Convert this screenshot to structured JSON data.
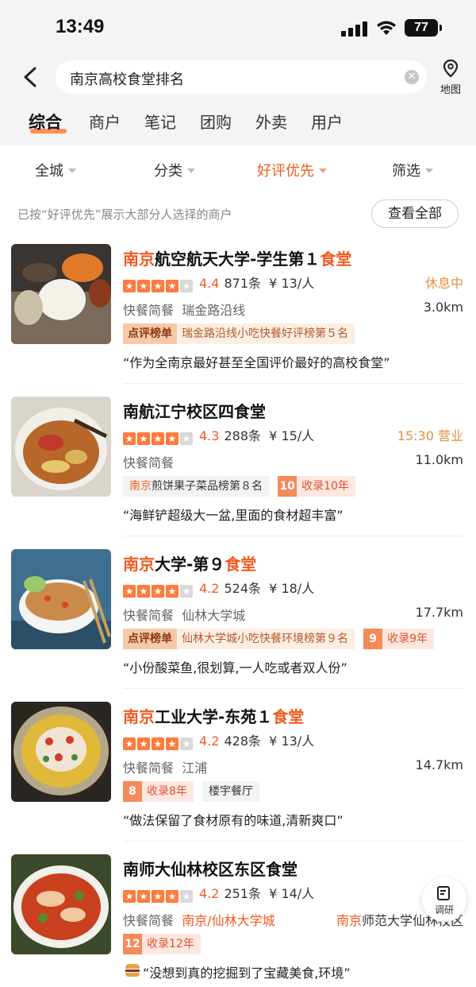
{
  "status_bar": {
    "time": "13:49",
    "battery": "77"
  },
  "search": {
    "query": "南京高校食堂排名",
    "map_label": "地图"
  },
  "tabs": [
    {
      "label": "综合",
      "active": true
    },
    {
      "label": "商户"
    },
    {
      "label": "笔记"
    },
    {
      "label": "团购"
    },
    {
      "label": "外卖"
    },
    {
      "label": "用户"
    }
  ],
  "filters": [
    {
      "label": "全城"
    },
    {
      "label": "分类"
    },
    {
      "label": "好评优先",
      "active": true
    },
    {
      "label": "筛选"
    }
  ],
  "notice": "已按“好评优先”展示大部分人选择的商户",
  "view_all": "查看全部",
  "accent_color": "#f05a20",
  "items": [
    {
      "title_parts": [
        "南京",
        "航空航天大学-学生第１",
        "食堂"
      ],
      "score": "4.4",
      "reviews": "871条",
      "price": "¥ 13/人",
      "status": "休息中",
      "meta_a": "快餐简餐",
      "meta_b": "瑞金路沿线",
      "distance": "3.0km",
      "rank_head": "点评榜单",
      "rank_text": "瑞金路沿线小吃快餐好评榜第５名",
      "quote": "“作为全南京最好甚至全国评价最好的高校食堂”"
    },
    {
      "title_parts": [
        "",
        "南航江宁校区四食堂",
        ""
      ],
      "score": "4.3",
      "reviews": "288条",
      "price": "¥ 15/人",
      "status": "15:30 营业",
      "meta_a": "快餐简餐",
      "meta_b": "",
      "distance": "11.0km",
      "plain_hl": "南京",
      "plain_text": "煎饼果子菜品榜第８名",
      "years_num": "10",
      "years_text": "收录10年",
      "quote": "“海鲜铲超级大一盆,里面的食材超丰富”"
    },
    {
      "title_parts": [
        "南京",
        "大学-第９",
        "食堂"
      ],
      "score": "4.2",
      "reviews": "524条",
      "price": "¥ 18/人",
      "meta_a": "快餐简餐",
      "meta_b": "仙林大学城",
      "distance": "17.7km",
      "rank_head": "点评榜单",
      "rank_text": "仙林大学城小吃快餐环境榜第９名",
      "years_num": "9",
      "years_text": "收录9年",
      "quote": "“小份酸菜鱼,很划算,一人吃或者双人份”"
    },
    {
      "title_parts": [
        "南京",
        "工业大学-东苑１",
        "食堂"
      ],
      "score": "4.2",
      "reviews": "428条",
      "price": "¥ 13/人",
      "meta_a": "快餐简餐",
      "meta_b": "江浦",
      "distance": "14.7km",
      "years_num": "8",
      "years_text": "收录8年",
      "plain_text": "楼宇餐厅",
      "quote": "“做法保留了食材原有的味道,清新爽口”"
    },
    {
      "title_parts": [
        "",
        "南师大仙林校区东区食堂",
        ""
      ],
      "score": "4.2",
      "reviews": "251条",
      "price": "¥ 14/人",
      "meta_a": "快餐简餐",
      "meta_b": "南京/仙林大学城",
      "meta_right_hl": "南京",
      "meta_right": "师范大学仙林校区",
      "years_num": "12",
      "years_text": "收录12年",
      "quote": "“没想到真的挖掘到了宝藏美食,环境”"
    }
  ],
  "float_label": "调研"
}
